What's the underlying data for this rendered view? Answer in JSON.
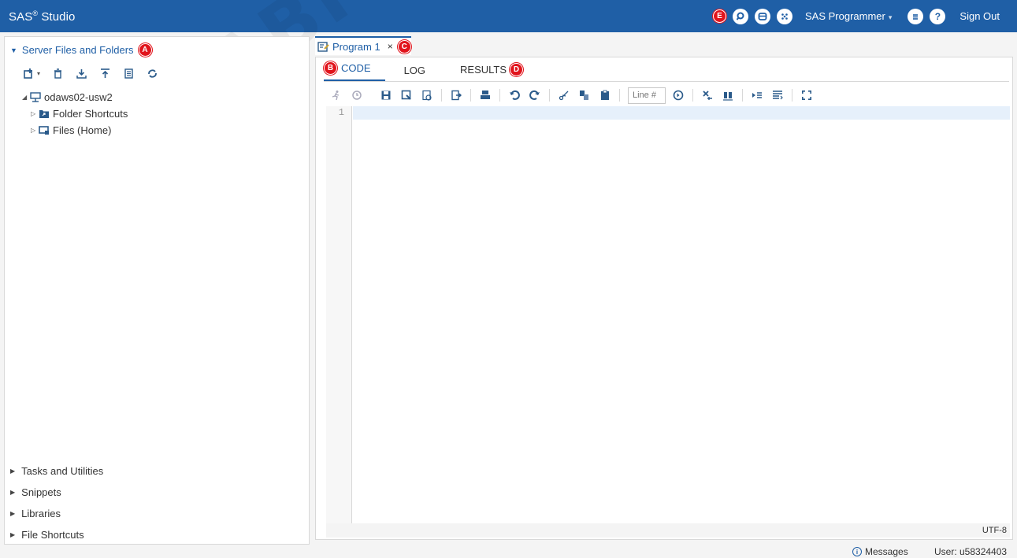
{
  "app": {
    "title": "SAS",
    "title_sup": "®",
    "title_rest": " Studio"
  },
  "topbar": {
    "badge_e": "E",
    "role": "SAS Programmer",
    "signout": "Sign Out",
    "help": "?"
  },
  "left": {
    "section_title": "Server Files and Folders",
    "badge_a": "A",
    "tree": [
      {
        "label": "odaws02-usw2"
      },
      {
        "label": "Folder Shortcuts"
      },
      {
        "label": "Files (Home)"
      }
    ],
    "bottom_sections": [
      "Tasks and Utilities",
      "Snippets",
      "Libraries",
      "File Shortcuts"
    ]
  },
  "editor": {
    "tab_title": "Program 1",
    "close": "×",
    "badge_c": "C",
    "subtabs": {
      "code": "CODE",
      "log": "LOG",
      "results": "RESULTS"
    },
    "badge_b": "B",
    "badge_d": "D",
    "lineno_placeholder": "Line #",
    "lines": [
      "1"
    ],
    "encoding": "UTF-8"
  },
  "footer": {
    "messages": "Messages",
    "user": "User: u58324403"
  },
  "watermark": "ARABPS",
  "colors": {
    "accent": "#1f5fa6",
    "badge": "#e1141c"
  }
}
